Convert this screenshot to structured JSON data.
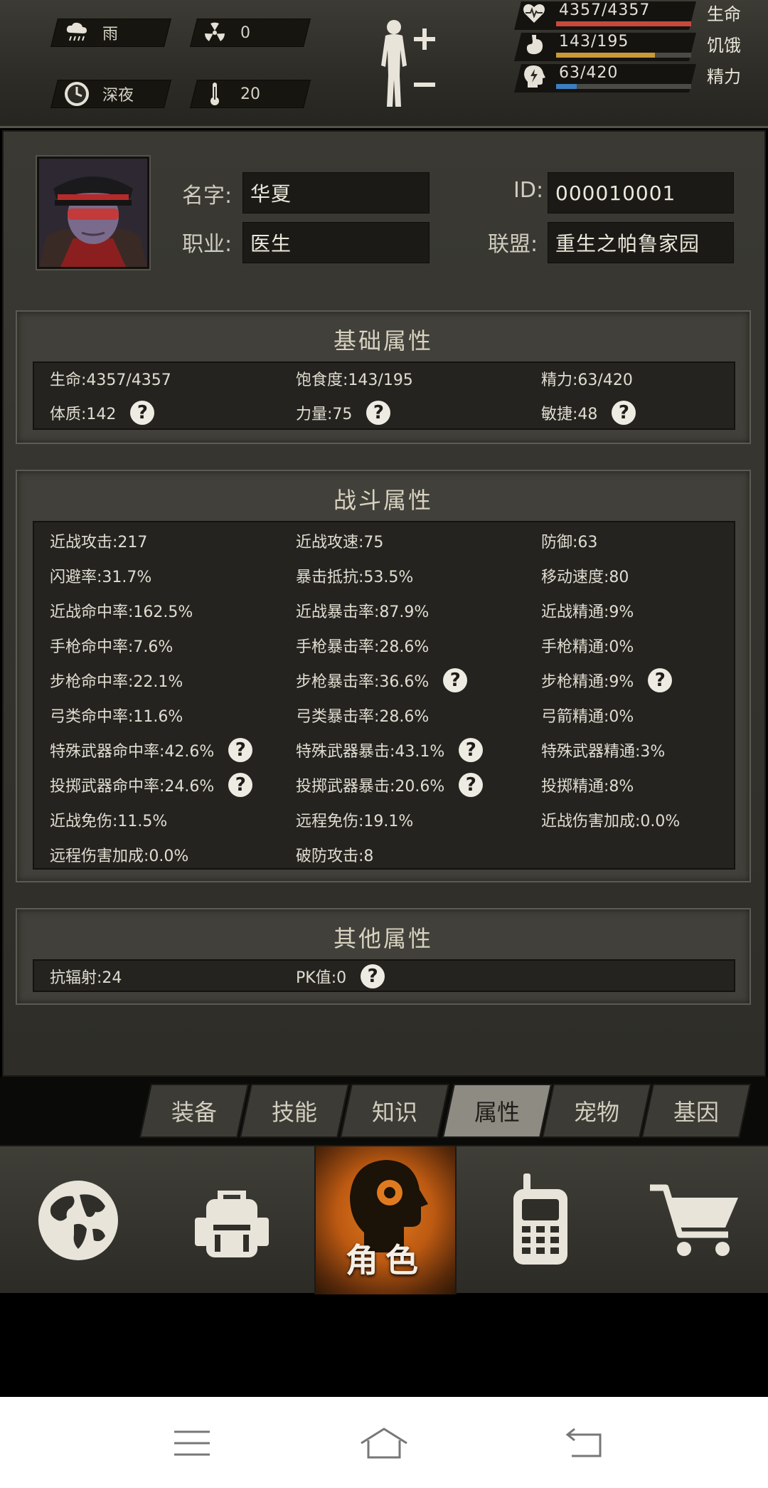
{
  "status": {
    "weather": "雨",
    "radiation": "0",
    "time_of_day": "深夜",
    "temperature": "20"
  },
  "vitals": [
    {
      "key": "life",
      "value": "4357/4357",
      "label": "生命",
      "fill": 1.0,
      "color": "#c8483c",
      "icon": "heart-pulse-icon"
    },
    {
      "key": "hunger",
      "value": "143/195",
      "label": "饥饿",
      "fill": 0.733,
      "color": "#c99a3a",
      "icon": "stomach-icon"
    },
    {
      "key": "energy",
      "value": "63/420",
      "label": "精力",
      "fill": 0.15,
      "color": "#3b7fc0",
      "icon": "head-bolt-icon"
    }
  ],
  "profile": {
    "name_label": "名字:",
    "name": "华夏",
    "id_label": "ID:",
    "id": "000010001",
    "job_label": "职业:",
    "job": "医生",
    "alliance_label": "联盟:",
    "alliance": "重生之帕鲁家园"
  },
  "basic": {
    "title": "基础属性",
    "cells": [
      {
        "text": "生命:4357/4357",
        "help": false
      },
      {
        "text": "饱食度:143/195",
        "help": false
      },
      {
        "text": "精力:63/420",
        "help": false
      },
      {
        "text": "体质:142",
        "help": true
      },
      {
        "text": "力量:75",
        "help": true
      },
      {
        "text": "敏捷:48",
        "help": true
      }
    ]
  },
  "combat": {
    "title": "战斗属性",
    "cells": [
      {
        "text": "近战攻击:217",
        "help": false
      },
      {
        "text": "近战攻速:75",
        "help": false
      },
      {
        "text": "防御:63",
        "help": false
      },
      {
        "text": "闪避率:31.7%",
        "help": false
      },
      {
        "text": "暴击抵抗:53.5%",
        "help": false
      },
      {
        "text": "移动速度:80",
        "help": false
      },
      {
        "text": "近战命中率:162.5%",
        "help": false
      },
      {
        "text": "近战暴击率:87.9%",
        "help": false
      },
      {
        "text": "近战精通:9%",
        "help": false
      },
      {
        "text": "手枪命中率:7.6%",
        "help": false
      },
      {
        "text": "手枪暴击率:28.6%",
        "help": false
      },
      {
        "text": "手枪精通:0%",
        "help": false
      },
      {
        "text": "步枪命中率:22.1%",
        "help": false
      },
      {
        "text": "步枪暴击率:36.6%",
        "help": true
      },
      {
        "text": "步枪精通:9%",
        "help": true
      },
      {
        "text": "弓类命中率:11.6%",
        "help": false
      },
      {
        "text": "弓类暴击率:28.6%",
        "help": false
      },
      {
        "text": "弓箭精通:0%",
        "help": false
      },
      {
        "text": "特殊武器命中率:42.6%",
        "help": true
      },
      {
        "text": "特殊武器暴击:43.1%",
        "help": true
      },
      {
        "text": "特殊武器精通:3%",
        "help": false
      },
      {
        "text": "投掷武器命中率:24.6%",
        "help": true
      },
      {
        "text": "投掷武器暴击:20.6%",
        "help": true
      },
      {
        "text": "投掷精通:8%",
        "help": false
      },
      {
        "text": "近战免伤:11.5%",
        "help": false
      },
      {
        "text": "远程免伤:19.1%",
        "help": false
      },
      {
        "text": "近战伤害加成:0.0%",
        "help": false
      },
      {
        "text": "远程伤害加成:0.0%",
        "help": false
      },
      {
        "text": "破防攻击:8",
        "help": false
      }
    ]
  },
  "other": {
    "title": "其他属性",
    "cells": [
      {
        "text": "抗辐射:24",
        "help": false
      },
      {
        "text": "PK值:0",
        "help": true
      }
    ]
  },
  "help_glyph": "?",
  "tabs": [
    "装备",
    "技能",
    "知识",
    "属性",
    "宠物",
    "基因"
  ],
  "active_tab": "属性",
  "nav": {
    "role_label": "角色"
  }
}
